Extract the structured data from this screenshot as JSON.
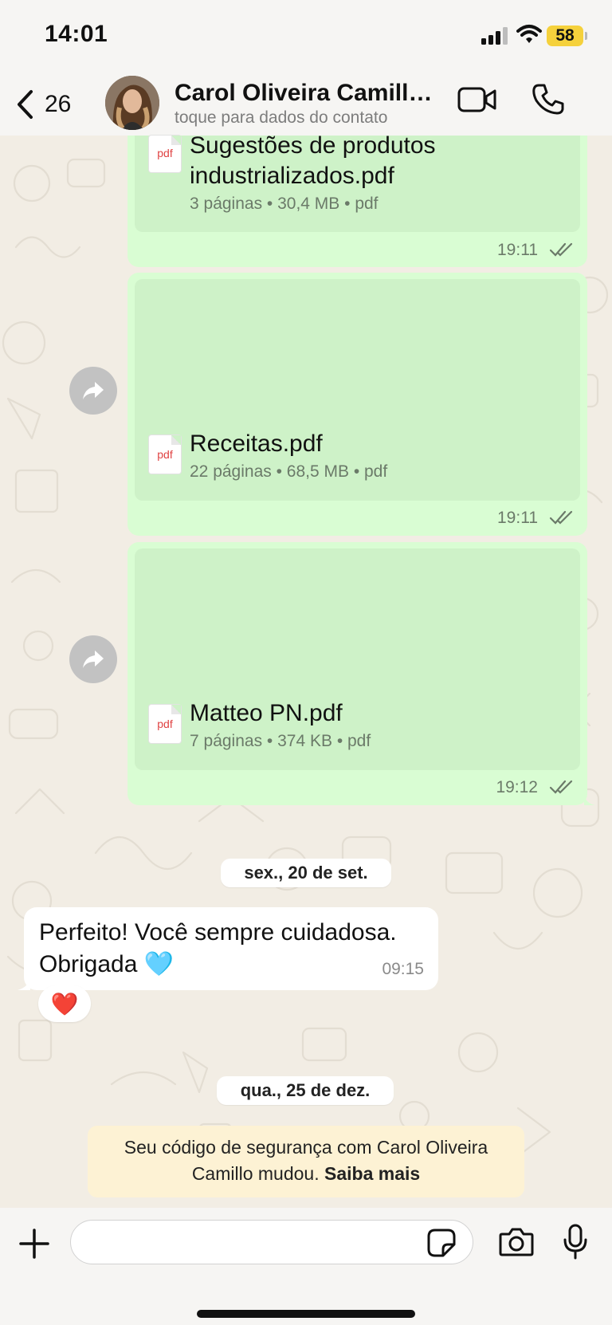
{
  "status_bar": {
    "time": "14:01",
    "battery": "58"
  },
  "header": {
    "back_count": "26",
    "contact_name": "Carol Oliveira Camillo...",
    "contact_subtitle": "toque para dados do contato"
  },
  "messages_out": [
    {
      "doc_name_line1": "Sugestões de produtos",
      "doc_name_line2": "industrializados.pdf",
      "meta": "3 páginas • 30,4 MB • pdf",
      "time": "19:11",
      "pdf_label": "pdf"
    },
    {
      "doc_name_line1": "Receitas.pdf",
      "meta": "22 páginas • 68,5 MB • pdf",
      "time": "19:11",
      "pdf_label": "pdf"
    },
    {
      "doc_name_line1": "Matteo PN.pdf",
      "meta": "7 páginas • 374 KB • pdf",
      "time": "19:12",
      "pdf_label": "pdf"
    }
  ],
  "date_separators": [
    "sex., 20 de set.",
    "qua., 25 de dez."
  ],
  "message_in": {
    "line1": "Perfeito! Você sempre cuidadosa.",
    "line2": "Obrigada 🩵",
    "time": "09:15",
    "reaction": "❤️"
  },
  "security_notice": {
    "text_line1": "Seu código de segurança com Carol Oliveira",
    "text_line2": "Camillo mudou.",
    "link": "Saiba mais"
  },
  "input": {
    "placeholder": ""
  },
  "colors": {
    "outgoing_bubble": "#d9fdd3",
    "doc_card": "#cef2c8",
    "notice_bg": "#fdf2d4",
    "battery": "#f5d13c"
  }
}
